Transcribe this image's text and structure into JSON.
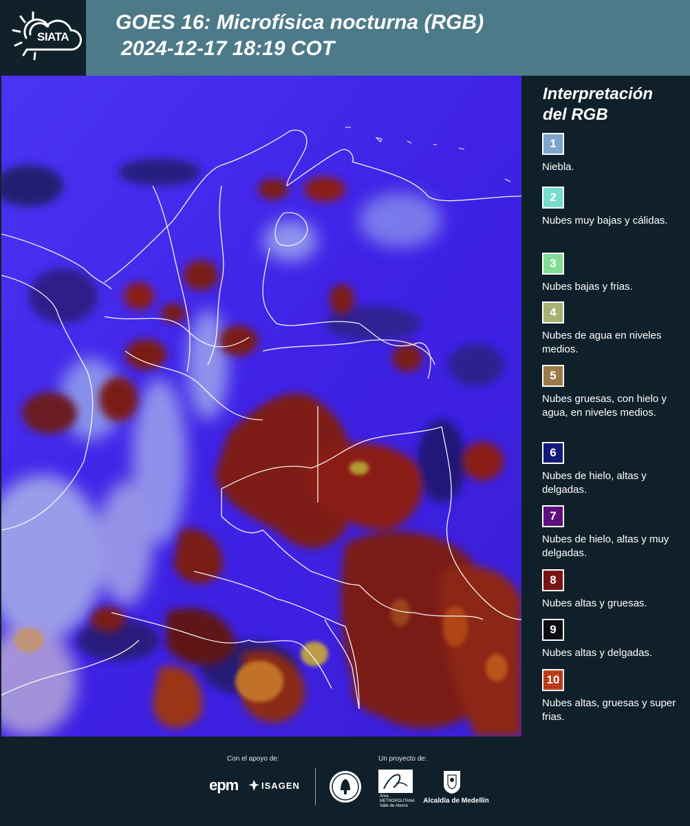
{
  "header": {
    "logo_text": "SIATA",
    "title_line1": "GOES 16: Microfísica nocturna (RGB)",
    "title_line2": "2024-12-17 18:19 COT"
  },
  "legend": {
    "title_line1": "Interpretación",
    "title_line2": "del RGB",
    "items": [
      {
        "num": "1",
        "label": "Niebla.",
        "color": "#7fa5cb"
      },
      {
        "num": "2",
        "label": "Nubes muy bajas y cálidas.",
        "color": "#76dccd"
      },
      {
        "num": "3",
        "label": "Nubes bajas y frias.",
        "color": "#83dc96"
      },
      {
        "num": "4",
        "label": "Nubes de agua en niveles medios.",
        "color": "#a6b173"
      },
      {
        "num": "5",
        "label": "Nubes gruesas, con hielo y agua, en niveles medios.",
        "color": "#9a7a4a"
      },
      {
        "num": "6",
        "label": "Nubes de hielo, altas y delgadas.",
        "color": "#141a7a"
      },
      {
        "num": "7",
        "label": "Nubes de hielo, altas y muy delgadas.",
        "color": "#5e0f7e"
      },
      {
        "num": "8",
        "label": "Nubes altas y gruesas.",
        "color": "#7a1414"
      },
      {
        "num": "9",
        "label": "Nubes altas y delgadas.",
        "color": "#0b0b12"
      },
      {
        "num": "10",
        "label": "Nubes altas, gruesas y super frias.",
        "color": "#b02a12"
      }
    ]
  },
  "footer": {
    "support_label": "Con el apoyo de:",
    "project_label": "Un proyecto de:",
    "epm": "epm",
    "isagen": "ISAGEN",
    "area_logo_text": "Área METROPOLITANA Valle de Aburrá",
    "alcaldia": "Alcaldía de Medellín"
  },
  "colors": {
    "header_bg": "#4d7a88",
    "panel_bg": "#10202a",
    "map_base": "#4a2cf0",
    "map_deep_red": "#7d1a12",
    "map_cloud_light": "#b8c7e8"
  }
}
